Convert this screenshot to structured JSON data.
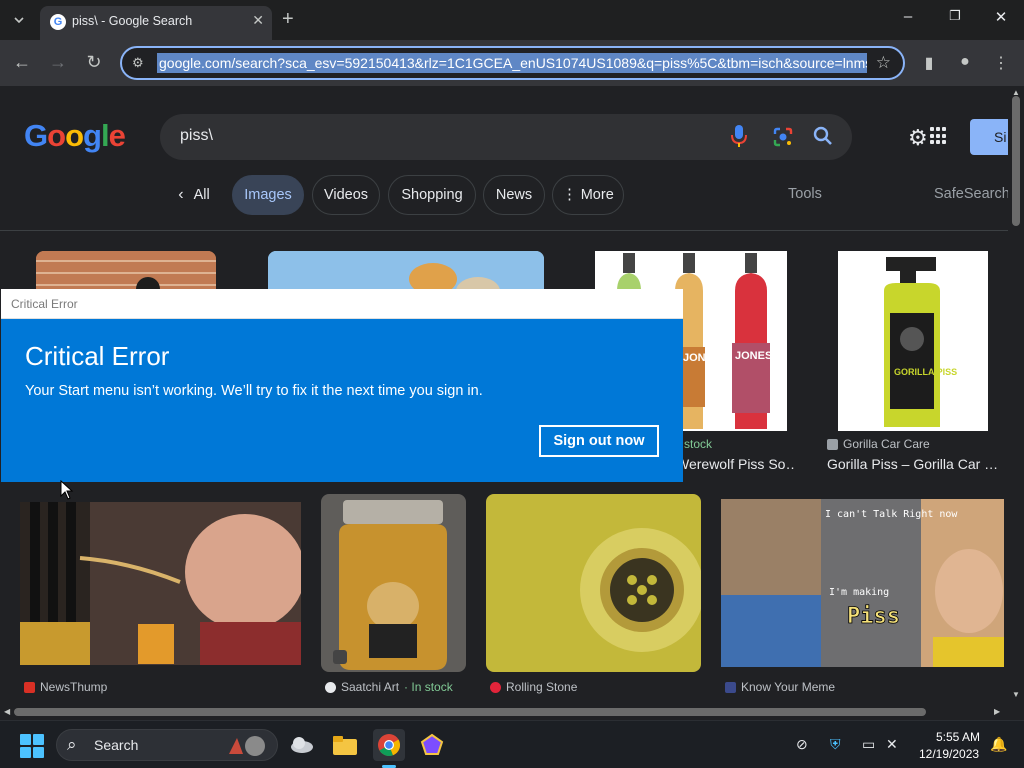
{
  "browser": {
    "tab_title": "piss\\ - Google Search",
    "url": "google.com/search?sca_esv=592150413&rlz=1C1GCEA_enUS1074US1089&q=piss%5C&tbm=isch&source=lnms&"
  },
  "google": {
    "query": "piss\\",
    "signin_label": "Si",
    "filters": {
      "all": "All",
      "images": "Images",
      "videos": "Videos",
      "shopping": "Shopping",
      "news": "News",
      "more": "More",
      "tools": "Tools",
      "safesearch": "SafeSearch"
    },
    "results": [
      {
        "source": "",
        "title": ""
      },
      {
        "source": "",
        "title": ""
      },
      {
        "source": "stock",
        "title": "Werewolf Piss So…"
      },
      {
        "source": "Gorilla Car Care",
        "title": "Gorilla Piss – Gorilla Car …"
      },
      {
        "source": "NewsThump",
        "title": ""
      },
      {
        "source": "Saatchi Art",
        "source_extra": "· In stock",
        "title": ""
      },
      {
        "source": "Rolling Stone",
        "title": ""
      },
      {
        "source": "Know Your Meme",
        "title": ""
      }
    ],
    "image_text": {
      "bottle_label": "JONES",
      "gorilla_label": "GORILLA PISS",
      "meme_top": "I can't Talk Right now",
      "meme_mid": "I'm making",
      "meme_word": "Piss"
    }
  },
  "dialog": {
    "window_title": "Critical Error",
    "heading": "Critical Error",
    "message": "Your Start menu isn’t working. We’ll try to fix it the next time you sign in.",
    "button": "Sign out now"
  },
  "taskbar": {
    "search_label": "Search",
    "time": "5:55 AM",
    "date": "12/19/2023"
  },
  "colors": {
    "dialog_blue": "#0078d7",
    "google_bg": "#202124",
    "chip_active": "#394457"
  }
}
